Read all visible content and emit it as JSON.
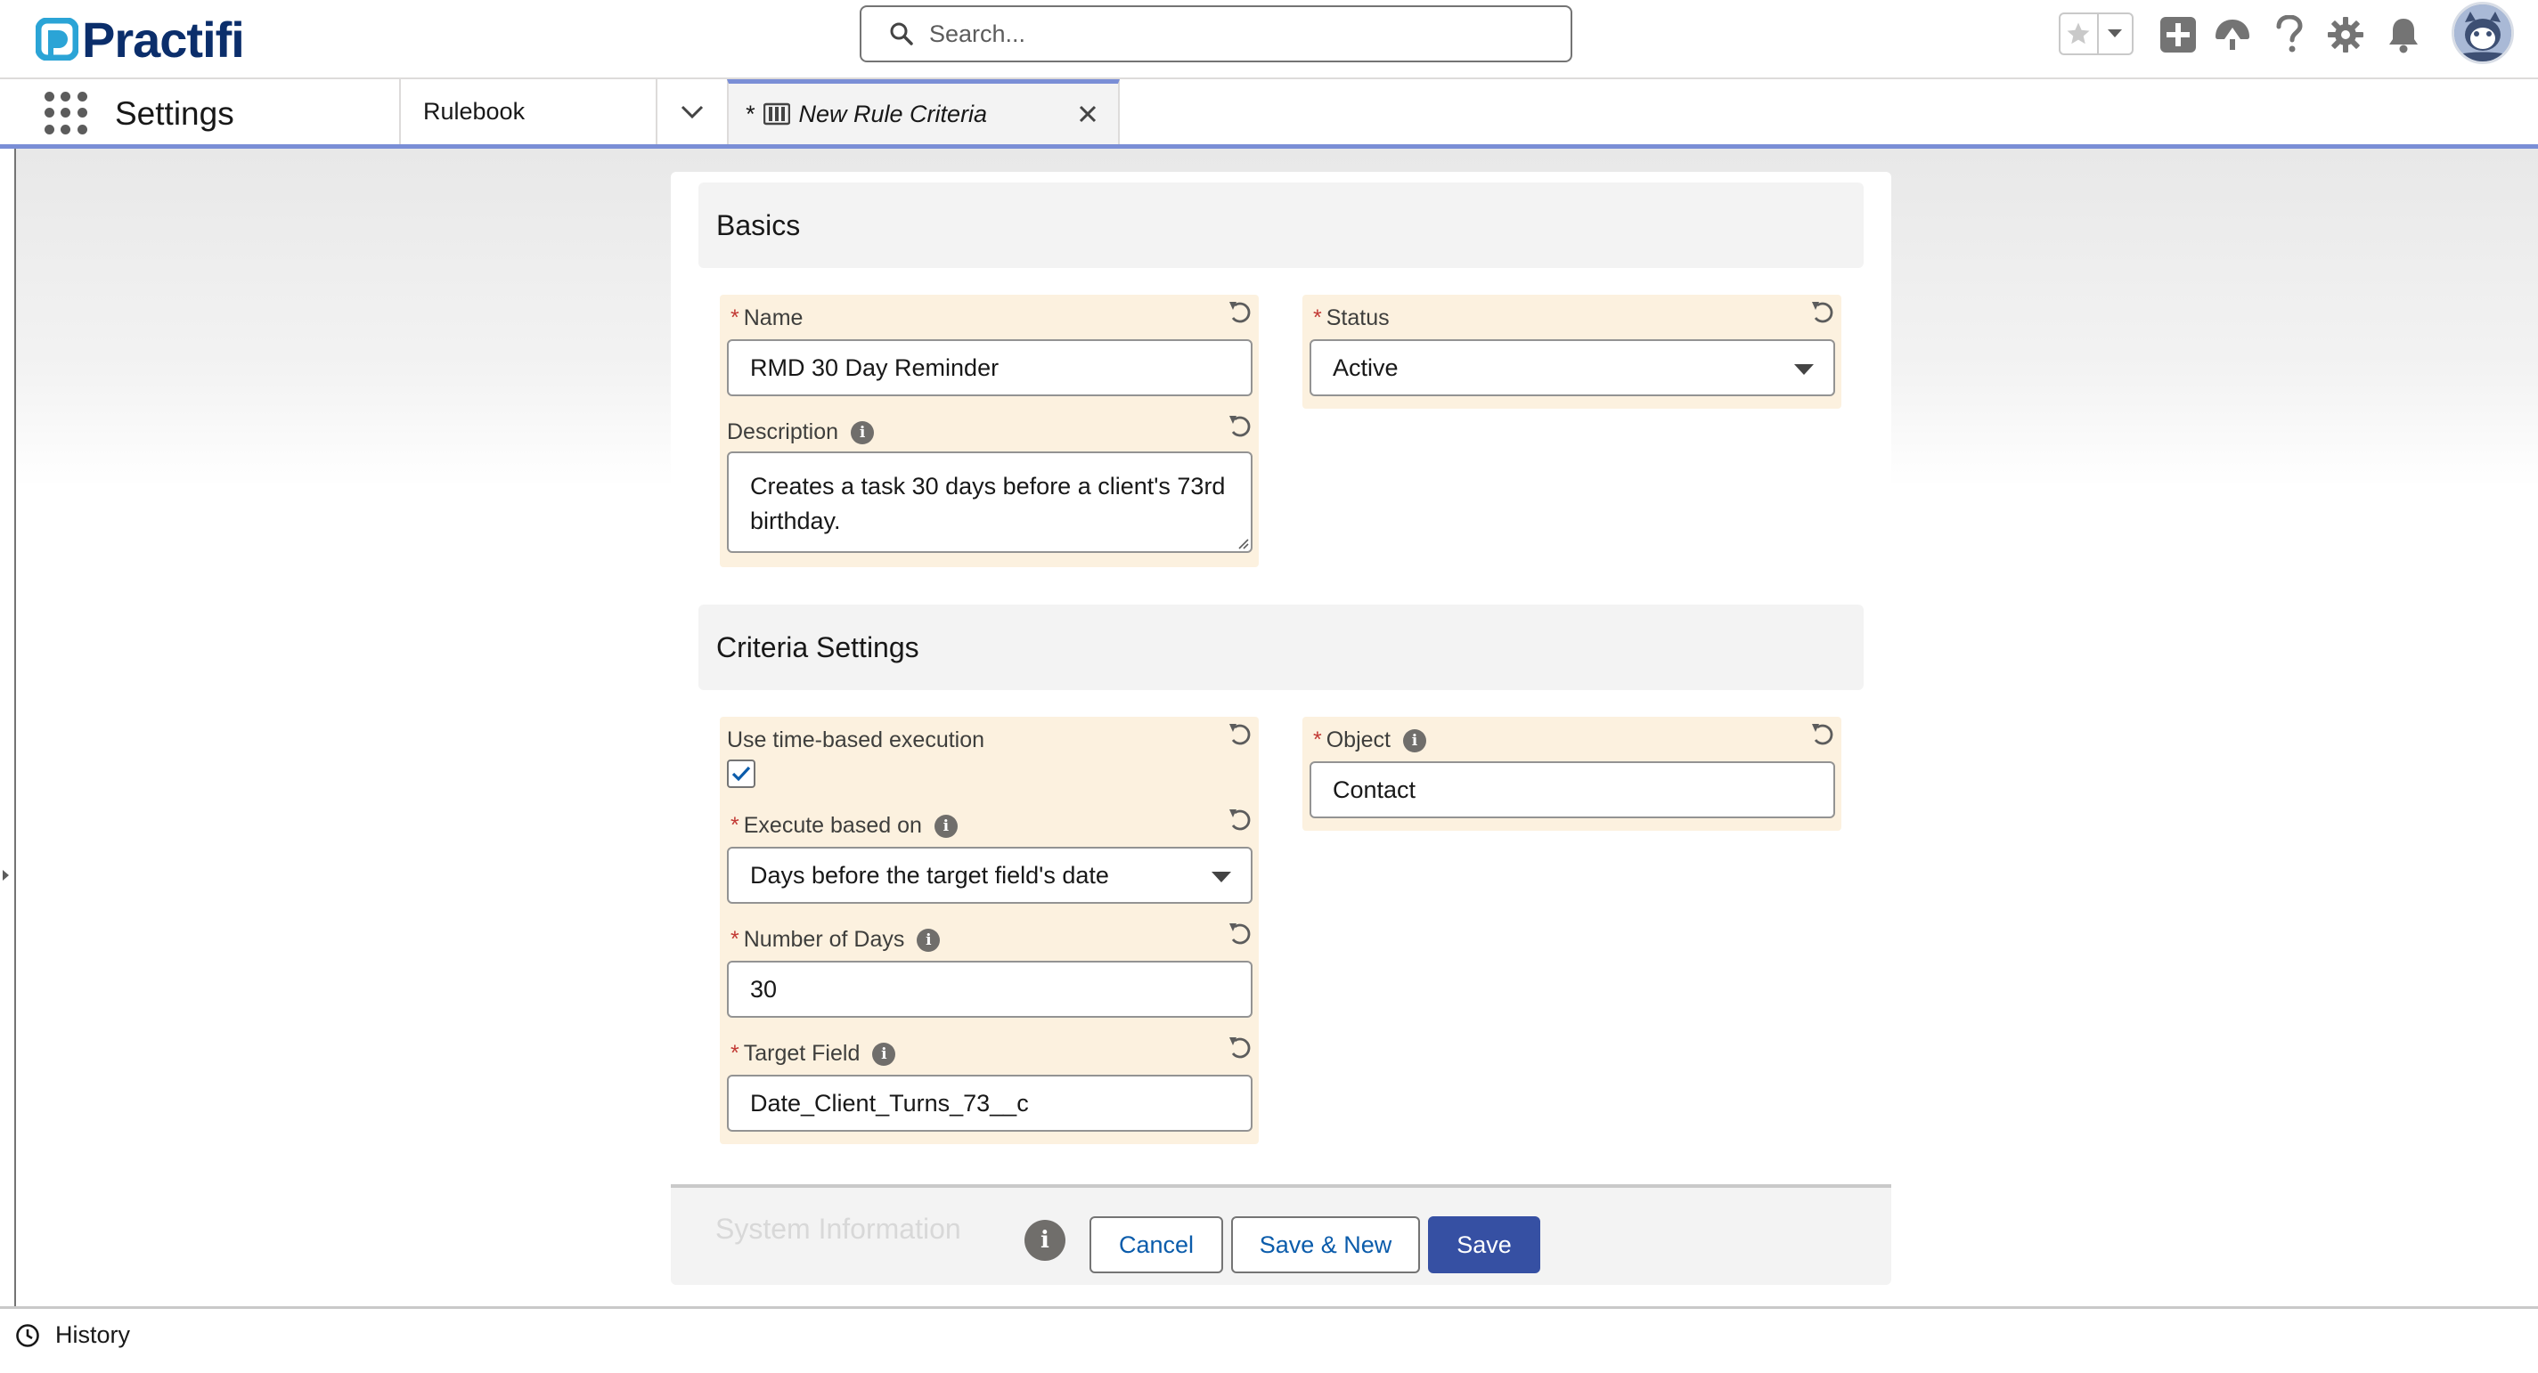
{
  "header": {
    "logo_text": "Practifi",
    "search_placeholder": "Search..."
  },
  "nav": {
    "app_name": "Settings",
    "tabs": [
      {
        "label": "Rulebook"
      },
      {
        "label": "New Rule Criteria",
        "dirty_marker": "*"
      }
    ]
  },
  "basics": {
    "heading": "Basics",
    "name": {
      "label": "Name",
      "required": "*",
      "value": "RMD 30 Day Reminder"
    },
    "description": {
      "label": "Description",
      "value": "Creates a task 30 days before a client's 73rd birthday."
    },
    "status": {
      "label": "Status",
      "required": "*",
      "value": "Active"
    }
  },
  "criteria": {
    "heading": "Criteria Settings",
    "time_based": {
      "label": "Use time-based execution",
      "checked": true
    },
    "execute_based_on": {
      "label": "Execute based on",
      "required": "*",
      "value": "Days before the target field's date"
    },
    "number_of_days": {
      "label": "Number of Days",
      "required": "*",
      "value": "30"
    },
    "target_field": {
      "label": "Target Field",
      "required": "*",
      "value": "Date_Client_Turns_73__c"
    },
    "object": {
      "label": "Object",
      "required": "*",
      "value": "Contact"
    }
  },
  "footer": {
    "system_info": "System Information",
    "cancel": "Cancel",
    "save_new": "Save & New",
    "save": "Save"
  },
  "utility": {
    "history": "History"
  },
  "colors": {
    "brand": "#3650a3",
    "link": "#0b5cab",
    "field_highlight": "#fcf1df",
    "nav_accent": "#7a8ed6",
    "logo": "#0b2e6b"
  }
}
